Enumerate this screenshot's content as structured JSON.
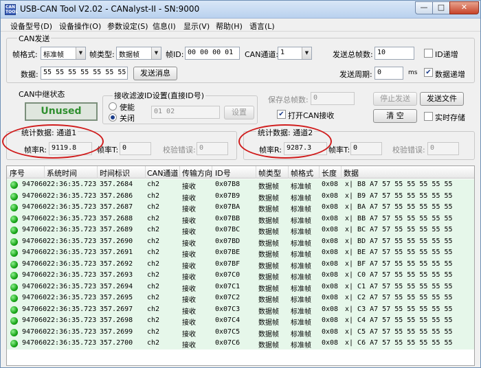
{
  "window": {
    "title": "USB-CAN Tool V2.02 - CANalyst-II - SN:9000",
    "icon_label": "CAN TOOL",
    "buttons": {
      "minimize": "—",
      "maximize": "□",
      "close": "✕"
    }
  },
  "menu": [
    "设备型号(D)",
    "设备操作(O)",
    "参数设定(S)",
    "信息(I)",
    "显示(V)",
    "帮助(H)",
    "语言(L)"
  ],
  "can_send": {
    "group_title": "CAN发送",
    "frame_format_label": "帧格式:",
    "frame_format_value": "标准帧",
    "frame_type_label": "帧类型:",
    "frame_type_value": "数据帧",
    "frame_id_label": "帧ID:",
    "frame_id_value": "00 00 00 01",
    "can_channel_label": "CAN通道:",
    "can_channel_value": "1",
    "total_frames_label": "发送总帧数:",
    "total_frames_value": "10",
    "id_increment_label": "ID递增",
    "id_increment_checked": false,
    "data_label": "数据:",
    "data_value": "55 55 55 55 55 55 55 55",
    "send_button": "发送消息",
    "period_label": "发送周期:",
    "period_value": "0",
    "period_unit": "ms",
    "data_increment_label": "数据递增",
    "data_increment_checked": true
  },
  "relay": {
    "title": "CAN中继状态",
    "status": "Unused"
  },
  "filter": {
    "title": "接收滤波ID设置(直接ID号)",
    "enable_label": "使能",
    "disable_label": "关闭",
    "selected": "关闭",
    "value": "01 02",
    "set_button": "设置"
  },
  "controls": {
    "save_total_label": "保存总帧数:",
    "save_total_value": "0",
    "open_can_receive_label": "打开CAN接收",
    "open_can_receive_checked": true,
    "stop_send_button": "停止发送",
    "send_file_button": "发送文件",
    "clear_button": "清 空",
    "realtime_save_label": "实时存储",
    "realtime_save_checked": false
  },
  "stats": {
    "ch1": {
      "title": "统计数据: 通道1",
      "rate_r_label": "帧率R:",
      "rate_r_value": "9119.8",
      "rate_t_label": "帧率T:",
      "rate_t_value": "0",
      "error_label": "校验错误:",
      "error_value": "0"
    },
    "ch2": {
      "title": "统计数据: 通道2",
      "rate_r_label": "帧率R:",
      "rate_r_value": "9287.3",
      "rate_t_label": "帧率T:",
      "rate_t_value": "0",
      "error_label": "校验错误:",
      "error_value": "0"
    }
  },
  "table": {
    "columns": [
      "序号",
      "系统时间",
      "时间标识",
      "CAN通道",
      "传输方向",
      "ID号",
      "帧类型",
      "帧格式",
      "长度",
      "数据"
    ],
    "rows": [
      [
        "947060",
        "22:36:35.723",
        "357.2684",
        "ch2",
        "接收",
        "0x07B8",
        "数据帧",
        "标准帧",
        "0x08",
        "x| B8 A7 57 55 55 55 55 55"
      ],
      [
        "947060",
        "22:36:35.723",
        "357.2686",
        "ch2",
        "接收",
        "0x07B9",
        "数据帧",
        "标准帧",
        "0x08",
        "x| B9 A7 57 55 55 55 55 55"
      ],
      [
        "947060",
        "22:36:35.723",
        "357.2687",
        "ch2",
        "接收",
        "0x07BA",
        "数据帧",
        "标准帧",
        "0x08",
        "x| BA A7 57 55 55 55 55 55"
      ],
      [
        "947060",
        "22:36:35.723",
        "357.2688",
        "ch2",
        "接收",
        "0x07BB",
        "数据帧",
        "标准帧",
        "0x08",
        "x| BB A7 57 55 55 55 55 55"
      ],
      [
        "947060",
        "22:36:35.723",
        "357.2689",
        "ch2",
        "接收",
        "0x07BC",
        "数据帧",
        "标准帧",
        "0x08",
        "x| BC A7 57 55 55 55 55 55"
      ],
      [
        "947060",
        "22:36:35.723",
        "357.2690",
        "ch2",
        "接收",
        "0x07BD",
        "数据帧",
        "标准帧",
        "0x08",
        "x| BD A7 57 55 55 55 55 55"
      ],
      [
        "947060",
        "22:36:35.723",
        "357.2691",
        "ch2",
        "接收",
        "0x07BE",
        "数据帧",
        "标准帧",
        "0x08",
        "x| BE A7 57 55 55 55 55 55"
      ],
      [
        "947060",
        "22:36:35.723",
        "357.2692",
        "ch2",
        "接收",
        "0x07BF",
        "数据帧",
        "标准帧",
        "0x08",
        "x| BF A7 57 55 55 55 55 55"
      ],
      [
        "947060",
        "22:36:35.723",
        "357.2693",
        "ch2",
        "接收",
        "0x07C0",
        "数据帧",
        "标准帧",
        "0x08",
        "x| C0 A7 57 55 55 55 55 55"
      ],
      [
        "947060",
        "22:36:35.723",
        "357.2694",
        "ch2",
        "接收",
        "0x07C1",
        "数据帧",
        "标准帧",
        "0x08",
        "x| C1 A7 57 55 55 55 55 55"
      ],
      [
        "947060",
        "22:36:35.723",
        "357.2695",
        "ch2",
        "接收",
        "0x07C2",
        "数据帧",
        "标准帧",
        "0x08",
        "x| C2 A7 57 55 55 55 55 55"
      ],
      [
        "947060",
        "22:36:35.723",
        "357.2697",
        "ch2",
        "接收",
        "0x07C3",
        "数据帧",
        "标准帧",
        "0x08",
        "x| C3 A7 57 55 55 55 55 55"
      ],
      [
        "947060",
        "22:36:35.723",
        "357.2698",
        "ch2",
        "接收",
        "0x07C4",
        "数据帧",
        "标准帧",
        "0x08",
        "x| C4 A7 57 55 55 55 55 55"
      ],
      [
        "947060",
        "22:36:35.723",
        "357.2699",
        "ch2",
        "接收",
        "0x07C5",
        "数据帧",
        "标准帧",
        "0x08",
        "x| C5 A7 57 55 55 55 55 55"
      ],
      [
        "947060",
        "22:36:35.723",
        "357.2700",
        "ch2",
        "接收",
        "0x07C6",
        "数据帧",
        "标准帧",
        "0x08",
        "x| C6 A7 57 55 55 55 55 55"
      ]
    ]
  },
  "colors": {
    "row_background": "#e6f7ea",
    "status_dot": "#17a517",
    "highlight_ellipse": "#d01c1c",
    "unused_text": "#2f8f2f"
  }
}
